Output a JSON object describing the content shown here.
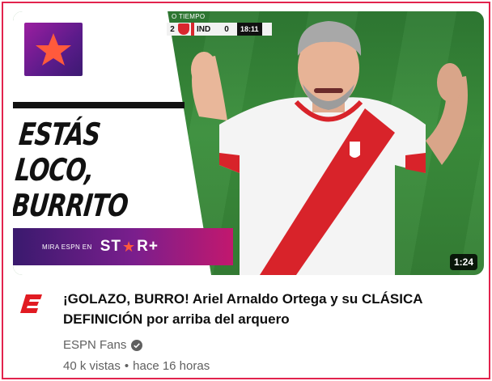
{
  "thumbnail": {
    "scorebug": {
      "period": "O TIEMPO",
      "home_score": "2",
      "away_team": "IND",
      "away_score": "0",
      "clock": "18:11"
    },
    "headline": [
      "ESTÁS LOCO,",
      "BURRITO"
    ],
    "promo": {
      "text": "MIRA ESPN EN",
      "brand_left": "ST",
      "brand_right": "R+"
    },
    "duration": "1:24",
    "logo_icon": "star-plus-logo",
    "colors": {
      "brand_purple": "#5a1b8a",
      "brand_pink": "#c2186e",
      "star_orange": "#ff5a3c"
    }
  },
  "video": {
    "title_line1": "¡GOLAZO, BURRO! Ariel Arnaldo Ortega y su CLÁSICA",
    "title_line2": "DEFINICIÓN por arriba del arquero",
    "channel": "ESPN Fans",
    "verified_icon": "verified-check-icon",
    "views": "40 k vistas",
    "separator": "•",
    "age": "hace 16 horas",
    "channel_icon": "espn-logo-icon"
  }
}
